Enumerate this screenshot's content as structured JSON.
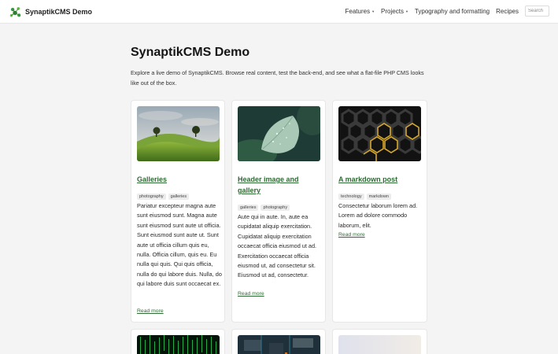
{
  "header": {
    "brand": "SynaptikCMS Demo",
    "nav": [
      {
        "label": "Features",
        "dropdown": true
      },
      {
        "label": "Projects",
        "dropdown": true
      },
      {
        "label": "Typography and formatting",
        "dropdown": false
      },
      {
        "label": "Recipes",
        "dropdown": false
      }
    ],
    "search_placeholder": "Search"
  },
  "main": {
    "title": "SynaptikCMS Demo",
    "intro": "Explore a live demo of SynaptikCMS. Browse real content, test the back-end, and see what a flat-file PHP CMS looks like out of the box."
  },
  "cards": [
    {
      "title": "Galleries",
      "tags": [
        "photography",
        "galleries"
      ],
      "excerpt": "Pariatur excepteur magna aute sunt eiusmod sunt. Magna aute sunt eiusmod sunt aute ut officia. Sunt eiusmod sunt aute ut. Sunt aute ut officia cillum quis eu, nulla. Officia cillum, quis eu. Eu nulla qui quis. Qui quis officia, nulla do qui labore duis. Nulla, do qui labore duis sunt occaecat ex.",
      "read_more": "Read more",
      "image": "green-hills-trees"
    },
    {
      "title": "Header image and gallery",
      "tags": [
        "galleries",
        "photography"
      ],
      "excerpt": "Aute qui in aute. In, aute ea cupidatat aliquip exercitation. Cupidatat aliquip exercitation occaecat officia eiusmod ut ad. Exercitation occaecat officia eiusmod ut, ad consectetur sit. Eiusmod ut ad, consectetur.",
      "read_more": "Read more",
      "image": "leaf-water-drops"
    },
    {
      "title": "A markdown post",
      "tags": [
        "technology",
        "markdown"
      ],
      "excerpt": "Consectetur laborum lorem ad. Lorem ad dolore commodo laborum, elit.",
      "read_more": "Read more",
      "image": "hexagon-grid"
    }
  ],
  "more_cards": [
    {
      "image": "green-code-matrix"
    },
    {
      "image": "circuit-board"
    },
    {
      "image": "soft-gradient"
    }
  ],
  "colors": {
    "link": "#2f6b35",
    "background": "#f4f4f4",
    "card": "#ffffff"
  }
}
